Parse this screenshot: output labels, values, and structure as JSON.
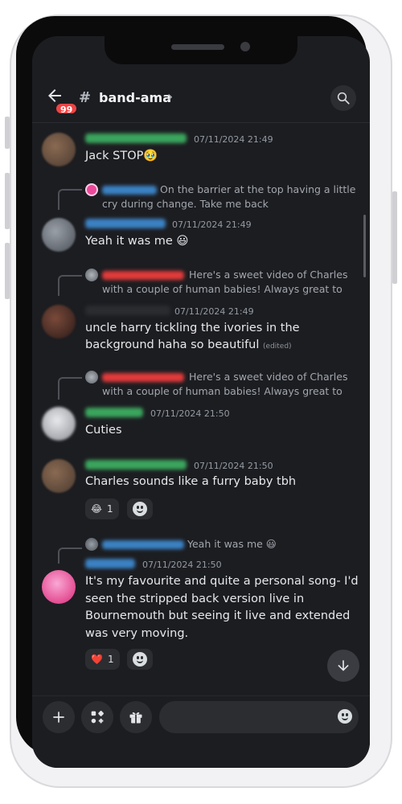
{
  "header": {
    "unread_badge": "99",
    "channel_hash": "#",
    "channel_name": "band-ama",
    "chevron": "›"
  },
  "colors": {
    "background": "#1c1d21",
    "accent_green": "#3ba55d",
    "accent_blue": "#3b82c4",
    "accent_red": "#e23b3b",
    "badge_red": "#ef4444"
  },
  "messages": [
    {
      "time": "07/11/2024 21:49",
      "text": "Jack STOP🥹"
    },
    {
      "reply_text": "On the barrier at the top having a little cry during change. Take me back",
      "time": "07/11/2024 21:49",
      "text": "Yeah it was me 😃"
    },
    {
      "reply_text": "Here's a sweet video of Charles with a couple of human babies! Always great to get a bi...",
      "time": "07/11/2024 21:49",
      "text": "uncle harry tickling the ivories in the background haha so beautiful",
      "edited": "(edited)"
    },
    {
      "reply_text": "Here's a sweet video of Charles with a couple of human babies! Always great to get a bi...",
      "time": "07/11/2024 21:50",
      "text": "Cuties"
    },
    {
      "time": "07/11/2024 21:50",
      "text": "Charles sounds like a furry baby tbh",
      "reaction_emoji": "😂",
      "reaction_count": "1"
    },
    {
      "reply_text": "Yeah it was me 😃",
      "time": "07/11/2024 21:50",
      "text": "It's my favourite and quite a personal song- I'd seen the stripped back version live in Bournemouth but seeing it live and extended was very moving.",
      "reaction_emoji": "❤️",
      "reaction_count": "1"
    }
  ],
  "composer": {
    "placeholder": ""
  }
}
